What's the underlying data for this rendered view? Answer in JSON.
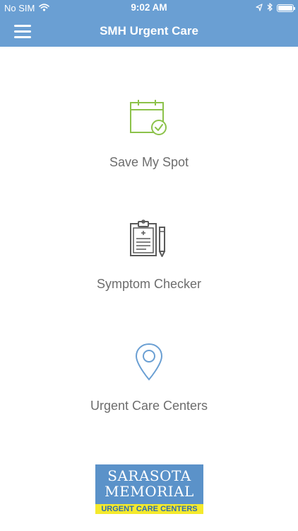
{
  "status_bar": {
    "carrier": "No SIM",
    "time": "9:02 AM"
  },
  "nav": {
    "title": "SMH Urgent Care"
  },
  "menu": {
    "items": [
      {
        "label": "Save My Spot",
        "icon": "calendar-check-icon"
      },
      {
        "label": "Symptom Checker",
        "icon": "clipboard-icon"
      },
      {
        "label": "Urgent Care Centers",
        "icon": "map-pin-icon"
      }
    ]
  },
  "logo": {
    "line1": "SARASOTA",
    "line2": "MEMORIAL",
    "tagline": "URGENT CARE CENTERS"
  },
  "colors": {
    "nav_background": "#6a9fd3",
    "calendar_icon": "#8cc24a",
    "clipboard_icon": "#5a5a5a",
    "map_pin_icon": "#6a9fd3",
    "label_text": "#6d6d6d",
    "logo_blue": "#5b92c9",
    "logo_yellow": "#f4e92c"
  }
}
